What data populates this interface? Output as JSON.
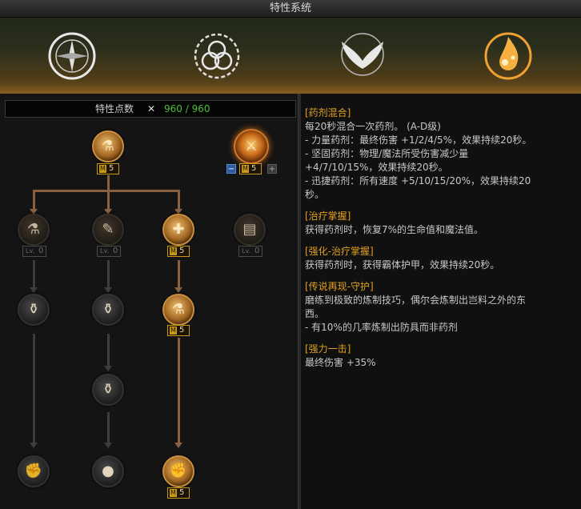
{
  "window": {
    "title": "特性系统"
  },
  "banner": {
    "emblems": [
      {
        "name": "compass-emblem"
      },
      {
        "name": "triquetra-emblem"
      },
      {
        "name": "wings-emblem"
      },
      {
        "name": "potion-flame-emblem"
      }
    ]
  },
  "points": {
    "label": "特性点数",
    "icon": "crossed-swords-icon",
    "value": "960 / 960"
  },
  "tree": {
    "root": {
      "level_badge": "M",
      "level": "5"
    },
    "ultimate": {
      "level_badge": "M",
      "level": "5",
      "minus": "−",
      "plus": "+"
    },
    "row2": [
      {
        "prefix": "Lv.",
        "level": "0"
      },
      {
        "prefix": "Lv.",
        "level": "0"
      },
      {
        "level_badge": "M",
        "level": "5"
      },
      {
        "prefix": "Lv.",
        "level": "0"
      }
    ],
    "col3_row3": {
      "level_badge": "M",
      "level": "5"
    },
    "col3_row5": {
      "level_badge": "M",
      "level": "5"
    }
  },
  "details": [
    {
      "title": "[药剂混合]",
      "body": "每20秒混合一次药剂。 (A-D级)\n- 力量药剂：最终伤害 +1/2/4/5%，效果持续20秒。\n- 坚固药剂：物理/魔法所受伤害减少量\n+4/7/10/15%，效果持续20秒。\n- 迅捷药剂：所有速度 +5/10/15/20%，效果持续20\n秒。"
    },
    {
      "title": "[治疗掌握]",
      "body": "获得药剂时，恢复7%的生命值和魔法值。"
    },
    {
      "title": "[强化-治疗掌握]",
      "body": "获得药剂时，获得霸体护甲，效果持续20秒。"
    },
    {
      "title": "[传说再现-守护]",
      "body": "磨练到极致的炼制技巧，偶尔会炼制出岂料之外的东\n西。\n- 有10%的几率炼制出防具而非药剂"
    },
    {
      "title": "[强力一击]",
      "body": "最终伤害 +35%"
    }
  ]
}
